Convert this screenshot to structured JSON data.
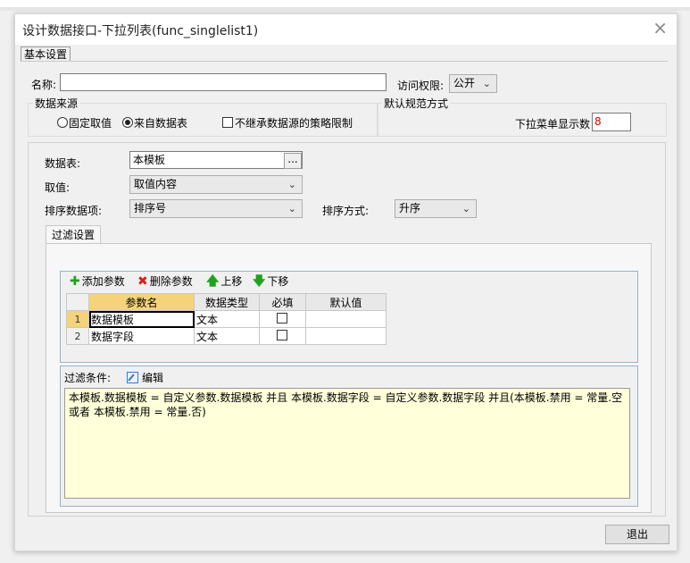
{
  "window": {
    "title": "设计数据接口-下拉列表(func_singlelist1)",
    "close_glyph": "×"
  },
  "tabs": {
    "basic": "基本设置",
    "filter": "过滤设置"
  },
  "name_field": {
    "label": "名称:",
    "value": ""
  },
  "access": {
    "label": "访问权限:",
    "value": "公开"
  },
  "data_source": {
    "legend": "数据来源",
    "options": [
      "固定取值",
      "来自数据表"
    ],
    "selected": "来自数据表",
    "checkbox_label": "不继承数据源的策略限制",
    "checkbox_checked": false
  },
  "default_spec": {
    "legend": "默认规范方式",
    "dropdown_count_label": "下拉菜单显示数",
    "dropdown_count_value": "8"
  },
  "form": {
    "table_label": "数据表:",
    "table_value": "本模板",
    "browse_label": "...",
    "value_label": "取值:",
    "value_value": "取值内容",
    "sort_field_label": "排序数据项:",
    "sort_field_value": "排序号",
    "sort_order_label": "排序方式:",
    "sort_order_value": "升序"
  },
  "toolbar": {
    "add": "添加参数",
    "delete": "删除参数",
    "up": "上移",
    "down": "下移"
  },
  "grid": {
    "headers": [
      "参数名",
      "数据类型",
      "必填",
      "默认值"
    ],
    "rows": [
      {
        "num": "1",
        "name": "数据模板",
        "type": "文本",
        "required": false,
        "default": ""
      },
      {
        "num": "2",
        "name": "数据字段",
        "type": "文本",
        "required": false,
        "default": ""
      }
    ]
  },
  "condition": {
    "label": "过滤条件:",
    "edit_label": "编辑",
    "text": "本模板.数据模板 = 自定义参数.数据模板 并且 本模板.数据字段 = 自定义参数.数据字段 并且(本模板.禁用 = 常量.空 或者 本模板.禁用 = 常量.否)"
  },
  "exit_label": "退出",
  "colors": {
    "add_icon": "#1fa31f",
    "delete_icon": "#d81e1e",
    "arrow_icon": "#1fa31f",
    "count_value": "#e00000",
    "highlight": "#f4d37a"
  }
}
